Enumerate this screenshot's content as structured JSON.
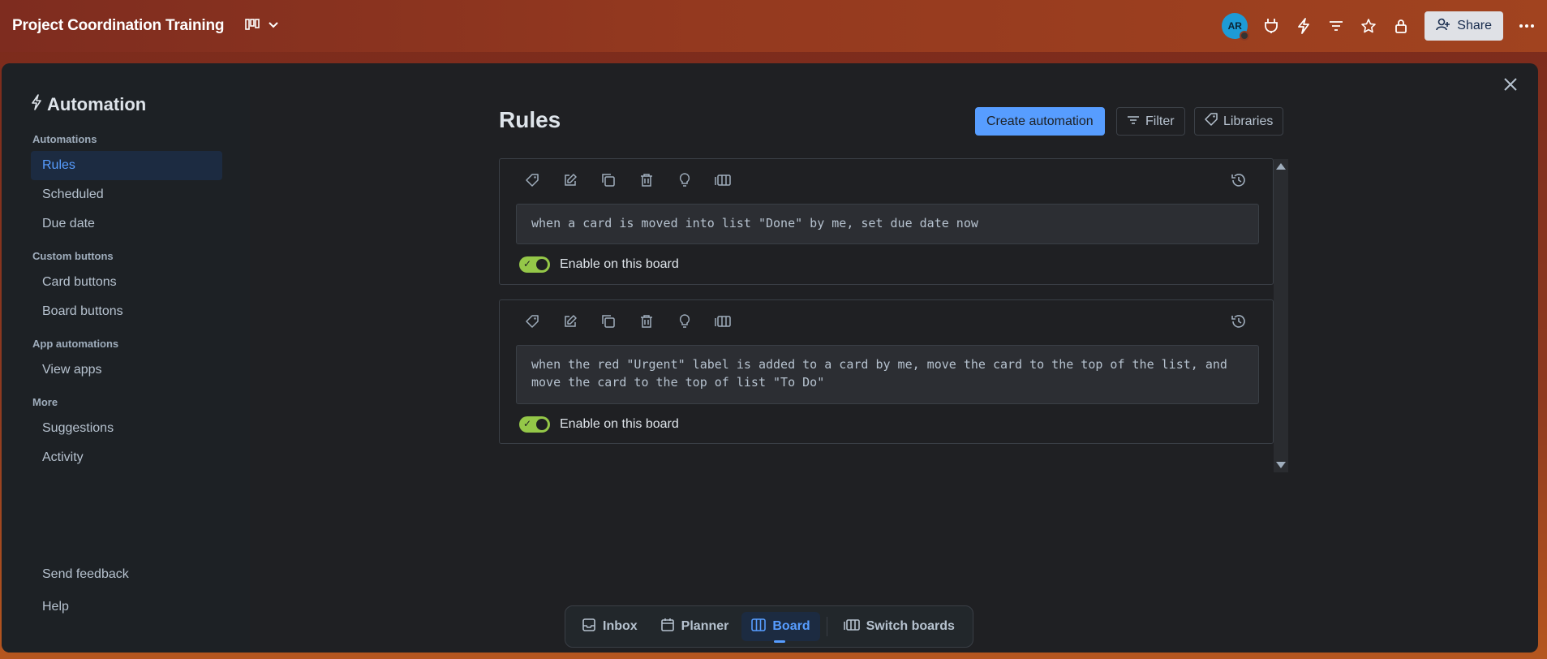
{
  "topbar": {
    "board_title": "Project Coordination Training",
    "avatar_initials": "AR",
    "share_label": "Share"
  },
  "sidebar": {
    "title": "Automation",
    "sections": [
      {
        "label": "Automations",
        "items": [
          {
            "label": "Rules",
            "active": true
          },
          {
            "label": "Scheduled"
          },
          {
            "label": "Due date"
          }
        ]
      },
      {
        "label": "Custom buttons",
        "items": [
          {
            "label": "Card buttons"
          },
          {
            "label": "Board buttons"
          }
        ]
      },
      {
        "label": "App automations",
        "items": [
          {
            "label": "View apps"
          }
        ]
      },
      {
        "label": "More",
        "items": [
          {
            "label": "Suggestions"
          },
          {
            "label": "Activity"
          }
        ]
      }
    ],
    "footer": [
      {
        "label": "Send feedback"
      },
      {
        "label": "Help"
      }
    ]
  },
  "main": {
    "title": "Rules",
    "create_label": "Create automation",
    "filter_label": "Filter",
    "libraries_label": "Libraries",
    "rules": [
      {
        "text": "when a card is moved into list \"Done\" by me, set due date now",
        "enabled": true,
        "toggle_label": "Enable on this board"
      },
      {
        "text": "when the red \"Urgent\" label is added to a card by me, move the card to the top of the list, and move the card to the top of list \"To Do\"",
        "enabled": true,
        "toggle_label": "Enable on this board"
      }
    ]
  },
  "bottom_nav": {
    "items": [
      {
        "label": "Inbox",
        "icon": "inbox-icon"
      },
      {
        "label": "Planner",
        "icon": "calendar-icon"
      },
      {
        "label": "Board",
        "icon": "board-icon",
        "active": true
      },
      {
        "label": "Switch boards",
        "icon": "switch-boards-icon"
      }
    ]
  },
  "colors": {
    "accent": "#579dff",
    "toggle_on": "#94c748",
    "modal_bg": "#1f2023",
    "sidebar_bg": "#1d2125"
  }
}
